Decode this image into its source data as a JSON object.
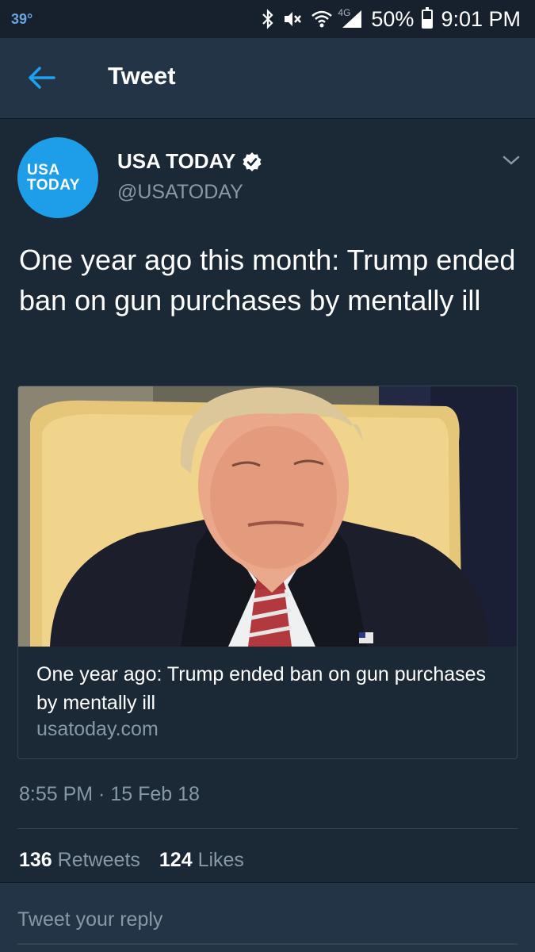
{
  "status_bar": {
    "temperature": "39°",
    "network": "4G",
    "battery": "50%",
    "battery_level": 0.5,
    "time": "9:01 PM"
  },
  "app_bar": {
    "title": "Tweet",
    "back_icon": "arrow-left-icon"
  },
  "tweet": {
    "avatar_line1": "USA",
    "avatar_line2": "TODAY",
    "author_name": "USA TODAY",
    "author_handle": "@USATODAY",
    "verified": true,
    "text": "One year ago this month: Trump ended ban on gun purchases by mentally ill",
    "card": {
      "title": "One year ago: Trump ended ban on gun purchases by mentally ill",
      "domain": "usatoday.com"
    },
    "timestamp": "8:55 PM · 15 Feb 18",
    "stats": {
      "retweets_count": "136",
      "retweets_label": "Retweets",
      "likes_count": "124",
      "likes_label": "Likes"
    }
  },
  "reply": {
    "placeholder": "Tweet your reply"
  },
  "colors": {
    "background": "#1b2836",
    "header": "#243447",
    "accent": "#1da1f2",
    "secondary_text": "#8899a6"
  }
}
